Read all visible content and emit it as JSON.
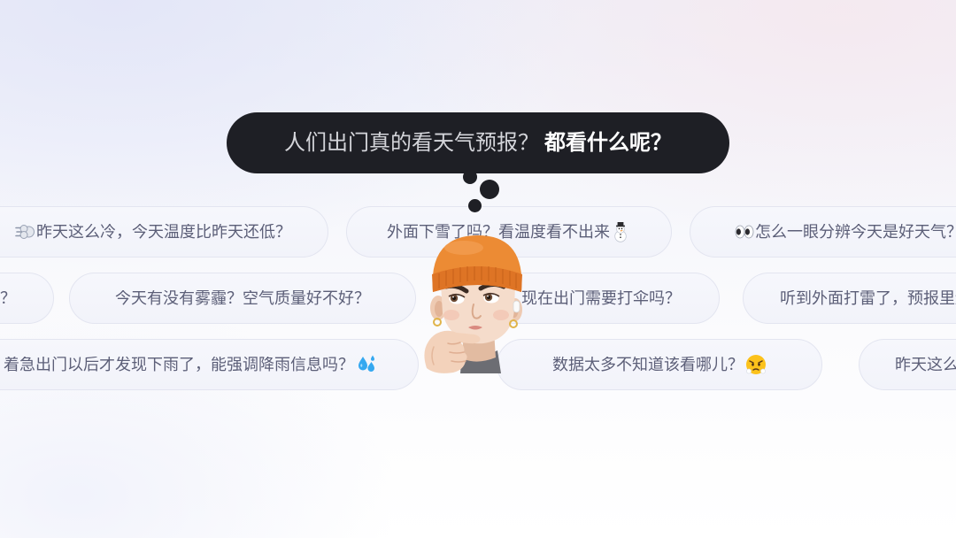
{
  "colors": {
    "bubble_background": "#1e1f25",
    "bubble_text": "#d4d5da",
    "bubble_emphasis": "#ffffff",
    "chip_background": "#f4f5fb",
    "chip_border": "#e3e5f0",
    "chip_text": "#5c5f78",
    "beanie": "#ec8b34"
  },
  "thought_bubble": {
    "question": "人们出门真的看天气预报？",
    "emphasis": "都看什么呢？"
  },
  "avatar": {
    "icon": "thinking-memoji-avatar"
  },
  "rows": [
    {
      "chips": [
        {
          "text": "昨天这么冷，今天温度比昨天还低？",
          "icon": "dashing-away-icon"
        },
        {
          "text": "外面下雪了吗？看温度看不出来",
          "icon": "snowman-icon"
        },
        {
          "text": "怎么一眼分辨今天是好天气？",
          "icon": "eyes-icon"
        }
      ]
    },
    {
      "chips": [
        {
          "text": "？"
        },
        {
          "text": "今天有没有雾霾？空气质量好不好？"
        },
        {
          "text": "现在出门需要打伞吗？"
        },
        {
          "text": "听到外面打雷了，预报里还"
        }
      ]
    },
    {
      "chips": [
        {
          "text": "着急出门以后才发现下雨了，能强调降雨信息吗？",
          "icon": "sweat-droplets-icon"
        },
        {
          "text": "数据太多不知道该看哪儿？",
          "icon": "face-with-steam-icon"
        },
        {
          "text": "昨天这么"
        }
      ]
    }
  ]
}
